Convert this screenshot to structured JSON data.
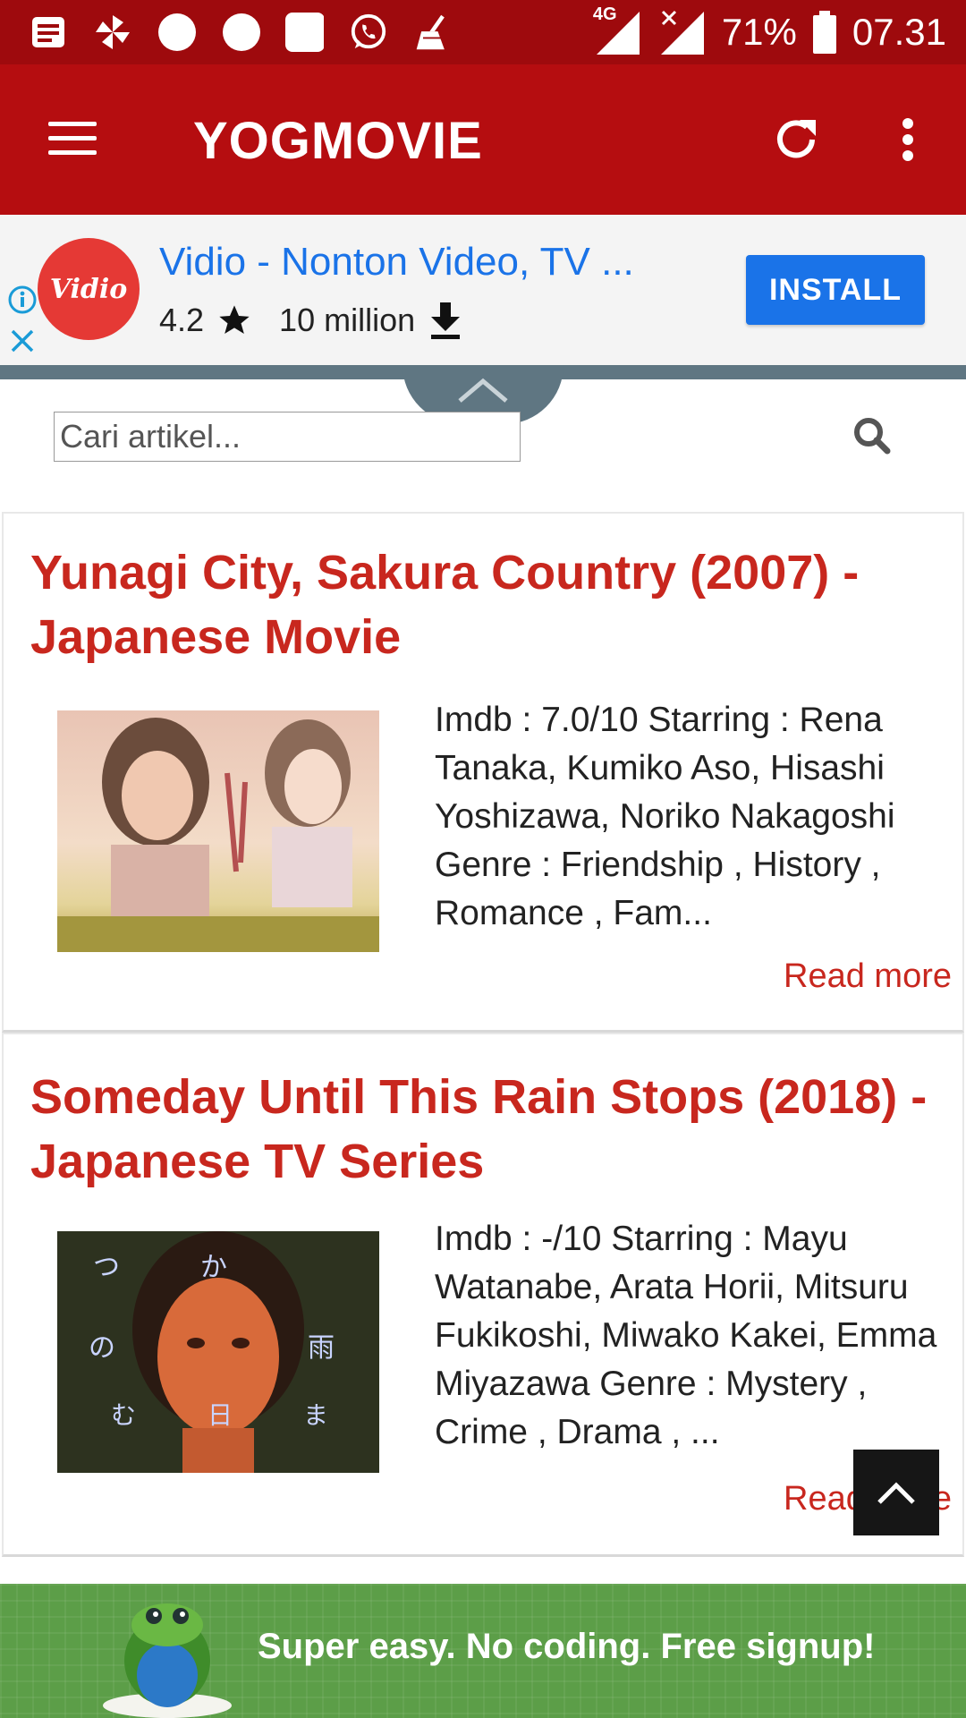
{
  "status_bar": {
    "network": "4G",
    "battery": "71%",
    "time": "07.31"
  },
  "app_bar": {
    "title": "YOGMOVIE"
  },
  "ad": {
    "logo_text": "Vidio",
    "title": "Vidio - Nonton Video, TV ...",
    "rating": "4.2",
    "downloads": "10 million",
    "install_label": "INSTALL"
  },
  "search": {
    "placeholder": "Cari artikel..."
  },
  "articles": [
    {
      "title": "Yunagi City, Sakura Country (2007) - Japanese Movie",
      "excerpt": "Imdb : 7.0/10 Starring : Rena Tanaka, Kumiko Aso, Hisashi Yoshizawa, Noriko Nakagoshi Genre : Friendship , History , Romance , Fam...",
      "read_more": "Read more"
    },
    {
      "title": "Someday Until This Rain Stops (2018) - Japanese TV Series",
      "excerpt": "Imdb : -/10 Starring : Mayu Watanabe, Arata Horii, Mitsuru Fukikoshi, Miwako Kakei, Emma Miyazawa Genre : Mystery , Crime , Drama , ...",
      "read_more": "Read more"
    }
  ],
  "bottom_ad": {
    "text": "Super easy. No coding. Free signup!"
  },
  "colors": {
    "status_bar": "#9e0a0d",
    "app_bar": "#b50d10",
    "article_title": "#c8271e",
    "install_button": "#1a73e8",
    "bottom_ad": "#5c9e48"
  }
}
